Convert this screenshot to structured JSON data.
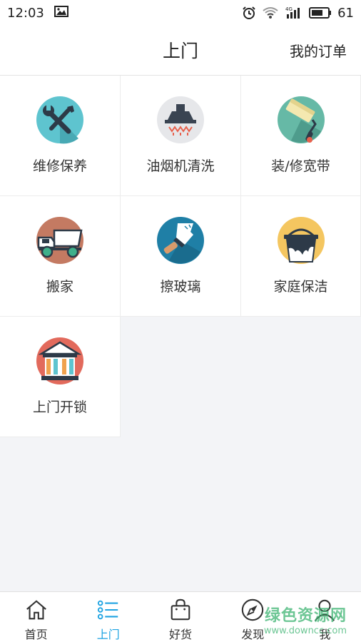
{
  "status": {
    "time": "12:03",
    "battery": "61",
    "network": "4G"
  },
  "header": {
    "title": "上门",
    "action": "我的订单"
  },
  "services": [
    {
      "label": "维修保养",
      "icon": "wrench-screwdriver-icon"
    },
    {
      "label": "油烟机清洗",
      "icon": "range-hood-icon"
    },
    {
      "label": "装/修宽带",
      "icon": "paint-roller-icon"
    },
    {
      "label": "搬家",
      "icon": "moving-truck-icon"
    },
    {
      "label": "擦玻璃",
      "icon": "window-squeegee-icon"
    },
    {
      "label": "家庭保洁",
      "icon": "cleaning-bucket-icon"
    },
    {
      "label": "上门开锁",
      "icon": "locksmith-building-icon"
    }
  ],
  "tabs": [
    {
      "label": "首页",
      "icon": "home-icon",
      "active": false
    },
    {
      "label": "上门",
      "icon": "list-icon",
      "active": true
    },
    {
      "label": "好货",
      "icon": "shopping-bag-icon",
      "active": false
    },
    {
      "label": "发现",
      "icon": "compass-icon",
      "active": false
    },
    {
      "label": "我",
      "icon": "user-icon",
      "active": false
    }
  ],
  "watermark": {
    "line1": "绿色资源网",
    "line2": "www.downcc.com"
  },
  "colors": {
    "accent": "#1ea3e2",
    "background": "#f3f4f7"
  }
}
